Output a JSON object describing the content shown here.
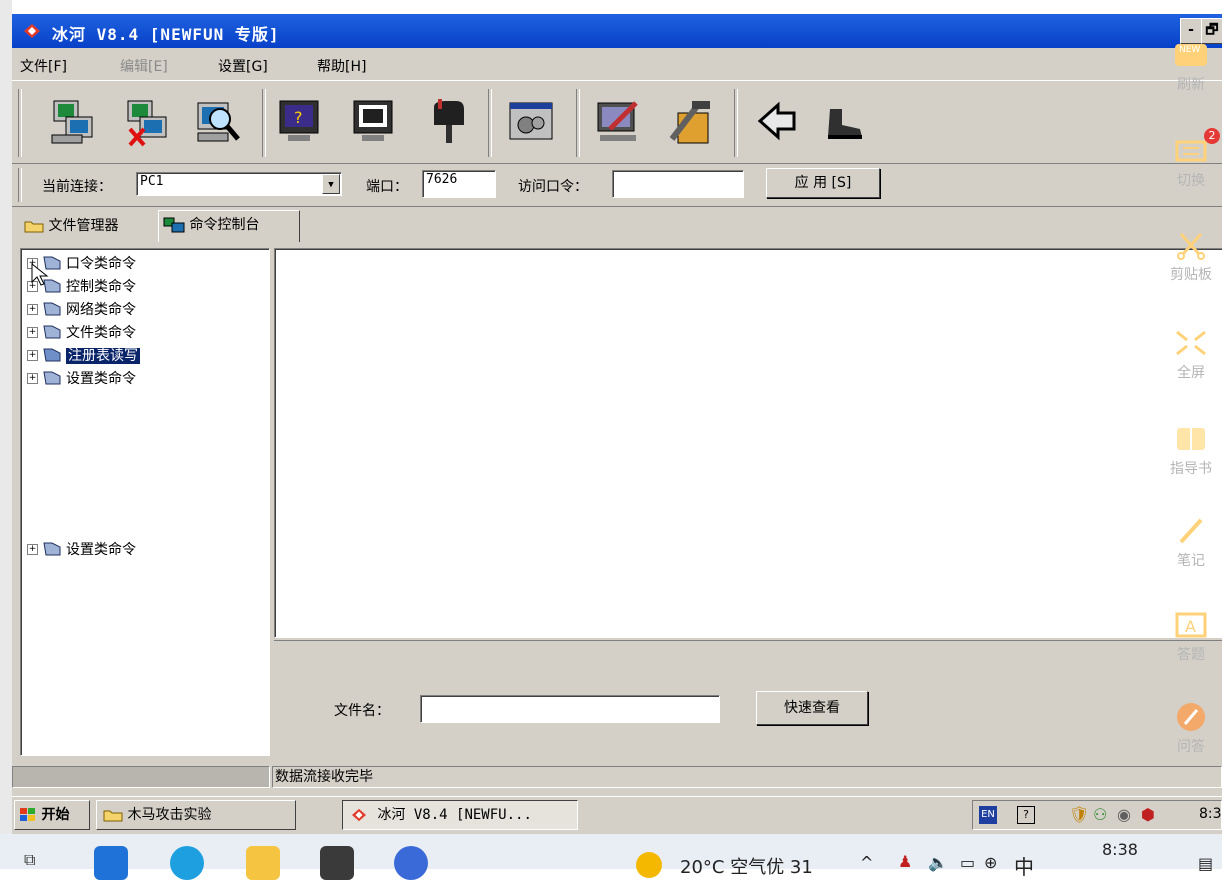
{
  "window": {
    "title": "冰河 V8.4 [NEWFUN 专版]",
    "controls": {
      "minimize": "-",
      "restore": "🗗"
    }
  },
  "menu": [
    {
      "label": "文件[F]",
      "enabled": true
    },
    {
      "label": "编辑[E]",
      "enabled": false
    },
    {
      "label": "设置[G]",
      "enabled": true
    },
    {
      "label": "帮助[H]",
      "enabled": true
    }
  ],
  "toolbar": {
    "icons": [
      "add-host-icon",
      "delete-host-icon",
      "search-host-icon",
      "help-screen-icon",
      "screen-capture-icon",
      "mailbox-icon",
      "settings-window-icon",
      "edit-computer-icon",
      "tools-icon",
      "back-arrow-icon",
      "boot-icon"
    ]
  },
  "connection": {
    "current_label": "当前连接：",
    "current_value": "PC1",
    "port_label": "端口：",
    "port_value": "7626",
    "password_label": "访问口令：",
    "password_value": "",
    "apply_label": "应 用 [S]"
  },
  "tabs": [
    {
      "label": "文件管理器",
      "active": false
    },
    {
      "label": "命令控制台",
      "active": true
    }
  ],
  "tree": {
    "items": [
      {
        "label": "口令类命令",
        "selected": false
      },
      {
        "label": "控制类命令",
        "selected": false
      },
      {
        "label": "网络类命令",
        "selected": false
      },
      {
        "label": "文件类命令",
        "selected": false
      },
      {
        "label": "注册表读写",
        "selected": true
      },
      {
        "label": "设置类命令",
        "selected": false
      }
    ],
    "extra_item": "设置类命令"
  },
  "bottom": {
    "filename_label": "文件名：",
    "filename_value": "",
    "quick_view_label": "快速查看"
  },
  "status": {
    "message": "数据流接收完毕"
  },
  "taskbar": {
    "start_label": "开始",
    "folder_label": "木马攻击实验",
    "active_window_label": "冰河 V8.4 [NEWFU...",
    "lang": "EN",
    "clock": "8:3"
  },
  "sidebar": {
    "items": [
      {
        "label": "刷新",
        "icon": "new-badge-icon"
      },
      {
        "label": "切换",
        "icon": "switch-icon",
        "badge": "2"
      },
      {
        "label": "剪贴板",
        "icon": "scissors-icon"
      },
      {
        "label": "全屏",
        "icon": "fullscreen-icon"
      },
      {
        "label": "指导书",
        "icon": "book-icon"
      },
      {
        "label": "笔记",
        "icon": "pen-icon"
      },
      {
        "label": "答题",
        "icon": "answer-icon"
      },
      {
        "label": "问答",
        "icon": "wrench-icon"
      }
    ]
  },
  "host_taskbar": {
    "weather": "20°C 空气优 31",
    "tray_text": "中",
    "time": "8:38"
  }
}
